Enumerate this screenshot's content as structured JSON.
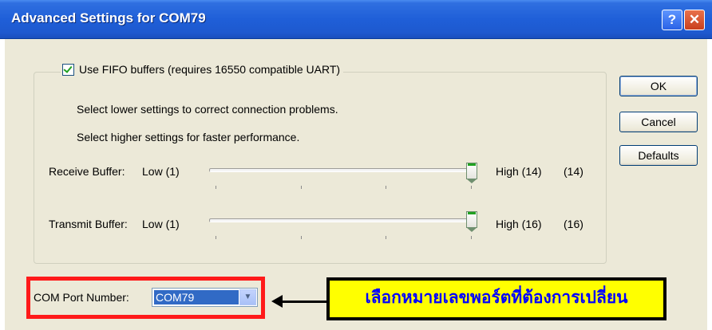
{
  "window": {
    "title": "Advanced Settings for COM79",
    "help_glyph": "?",
    "close_glyph": "✕"
  },
  "fifo": {
    "checkbox_label": "Use FIFO buffers (requires 16550 compatible UART)",
    "checked": true,
    "hint_lower": "Select lower settings to correct connection problems.",
    "hint_higher": "Select higher settings for faster performance."
  },
  "receive_buffer": {
    "label": "Receive Buffer:",
    "low_label": "Low (1)",
    "high_label": "High (14)",
    "value_text": "(14)",
    "level": 1.0
  },
  "transmit_buffer": {
    "label": "Transmit Buffer:",
    "low_label": "Low (1)",
    "high_label": "High (16)",
    "value_text": "(16)",
    "level": 1.0
  },
  "buttons": {
    "ok": "OK",
    "cancel": "Cancel",
    "defaults": "Defaults"
  },
  "com_port": {
    "label": "COM Port Number:",
    "selected": "COM79"
  },
  "annotation": {
    "text": "เลือกหมายเลขพอร์ตที่ต้องการเปลี่ยน"
  },
  "colors": {
    "titlebar": "#1f5fd8",
    "dialog_bg": "#ece9d8",
    "highlight_box": "#ff1a1a",
    "annotation_bg": "#ffff00",
    "annotation_text": "#0000ff"
  }
}
